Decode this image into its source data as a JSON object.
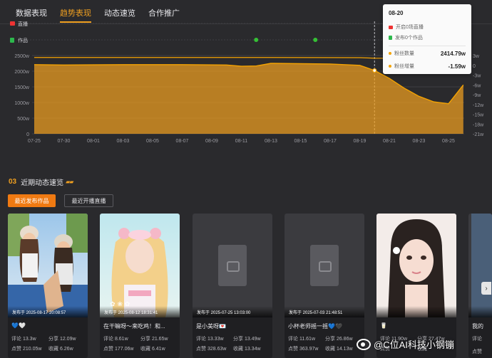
{
  "tabs": [
    {
      "label": "数据表现",
      "active": false
    },
    {
      "label": "趋势表现",
      "active": true
    },
    {
      "label": "动态速览",
      "active": false
    },
    {
      "label": "合作推广",
      "active": false
    }
  ],
  "chart_data": {
    "type": "area",
    "track_labels": {
      "live": "直播",
      "works": "作品"
    },
    "x_ticks": [
      "07-25",
      "07-30",
      "08-01",
      "08-03",
      "08-05",
      "08-07",
      "08-09",
      "08-11",
      "08-13",
      "08-15",
      "08-17",
      "08-19",
      "08-21",
      "08-23",
      "08-25"
    ],
    "y_left_ticks": [
      "0",
      "500w",
      "1000w",
      "1500w",
      "2000w",
      "2500w"
    ],
    "y_left_range": [
      0,
      2500
    ],
    "y_right_ticks": [
      "3w",
      "0",
      "-3w",
      "-6w",
      "-9w",
      "-12w",
      "-15w",
      "-18w",
      "-21w"
    ],
    "y_right_range": [
      -21,
      3
    ],
    "fans_count_series": {
      "x": [
        "07-25",
        "08-11",
        "08-12",
        "08-13",
        "08-19",
        "08-20",
        "08-25"
      ],
      "values": [
        2437,
        2438,
        2437,
        2438,
        2432,
        2414.79,
        2405
      ]
    },
    "fans_growth_series": {
      "x": [
        "07-25",
        "07-30",
        "08-03",
        "08-07",
        "08-10",
        "08-11",
        "08-12",
        "08-13",
        "08-17",
        "08-19",
        "08-20",
        "08-21",
        "08-22",
        "08-23",
        "08-24",
        "08-25",
        "08-26"
      ],
      "values": [
        0.2,
        0.1,
        0.2,
        0.2,
        0.1,
        -0.3,
        -0.2,
        0.6,
        0.4,
        0.0,
        -1.59,
        -4.0,
        -7.0,
        -9.5,
        -11.2,
        -11.8,
        -6.0
      ]
    },
    "works_markers": [
      "08-12",
      "08-16"
    ],
    "highlight_x": "08-20",
    "colors": {
      "area": "#f0a020",
      "line": "#f5a300",
      "marker": "#35c035",
      "grid": "#3d3d42"
    }
  },
  "tooltip": {
    "date": "08-20",
    "live_text": "开启0场直播",
    "works_text": "发布0个作品",
    "fans_count_label": "粉丝数量",
    "fans_count_value": "2414.79w",
    "fans_growth_label": "粉丝增量",
    "fans_growth_value": "-1.59w"
  },
  "section": {
    "number": "03",
    "title": "近期动态速览",
    "deco": "▰▰"
  },
  "buttons": {
    "recent_works": "最近发布作品",
    "recent_live": "最近开播直播"
  },
  "cards": [
    {
      "kind": "photo-two-girls",
      "published": "发布于 2025-08-17 20:08:57",
      "title": "💙🤍",
      "comments": "评论 13.3w",
      "shares": "分享 12.09w",
      "likes": "点赞 210.05w",
      "saves": "收藏 6.26w"
    },
    {
      "kind": "photo-lolita",
      "published": "发布于 2025-08-12 18:31:41",
      "title": "在干嘛呀～来吃鸡！和...",
      "comments": "评论 8.61w",
      "shares": "分享 21.65w",
      "likes": "点赞 177.06w",
      "saves": "收藏 6.41w"
    },
    {
      "kind": "placeholder",
      "published": "发布于 2025-07-25 13:03:00",
      "title": "是小美呀💌",
      "comments": "评论 13.33w",
      "shares": "分享 13.49w",
      "likes": "点赞 328.63w",
      "saves": "收藏 13.34w"
    },
    {
      "kind": "placeholder",
      "published": "发布于 2025-07-03 21:48:51",
      "title": "小杯老师摇一摇💙🖤",
      "comments": "评论 11.61w",
      "shares": "分享 26.86w",
      "likes": "点赞 363.97w",
      "saves": "收藏 14.13w"
    },
    {
      "kind": "photo-portrait",
      "published": "",
      "title": "🥛",
      "comments": "评论 11.90w",
      "shares": "分享 27.47w",
      "likes": "点赞",
      "saves": "收藏"
    },
    {
      "kind": "placeholder-partial",
      "published": "",
      "title": "我的",
      "comments": "评论",
      "shares": "",
      "likes": "点赞",
      "saves": ""
    }
  ],
  "watermark": {
    "text": "@C位AI科技小钢镚"
  },
  "icons": {
    "scroll_right": "chevron-right-icon"
  }
}
